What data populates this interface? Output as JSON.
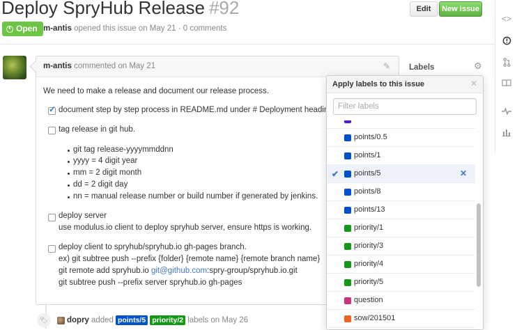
{
  "issue": {
    "title": "Deploy SpryHub Release",
    "number": "#92",
    "state": "Open",
    "author": "m-antis",
    "meta_text": "opened this issue on May 21 · 0 comments"
  },
  "header_buttons": {
    "edit": "Edit",
    "new_issue": "New issue"
  },
  "comment": {
    "author": "m-antis",
    "meta": "commented on May 21",
    "intro": "We need to make a release and document our release process.",
    "tasks": [
      {
        "checked": true,
        "text": "document step by step process in README.md under # Deployment heading."
      },
      {
        "checked": false,
        "text": "tag release in git hub."
      },
      {
        "checked": false,
        "text": "deploy server"
      },
      {
        "checked": false,
        "text": "deploy client to spryhub/spryhub.io gh-pages branch."
      }
    ],
    "tag_bullets": [
      "git tag release-yyyymmddnn",
      "yyyy = 4 digit year",
      "mm = 2 digit month",
      "dd = 2 digit day",
      "nn = manual release number or build number if generated by jenkins."
    ],
    "server_line": "use modulus.io client to deploy spryhub server, ensure https is working.",
    "client_lines": {
      "line1": "ex) git subtree push --prefix {folder} {remote name} {remote branch name}",
      "line2_prefix": "git remote add spryhub.io ",
      "line2_link": "git@github.com",
      "line2_suffix": ":spry-group/spryhub.io.git",
      "line3": "git subtree push --prefix server spryhub.io gh-pages"
    }
  },
  "event": {
    "actor": "dopry",
    "verb": "added",
    "labels": [
      {
        "name": "points/5",
        "color": "#0052cc"
      },
      {
        "name": "priority/2",
        "color": "#159818"
      }
    ],
    "suffix": "labels on May 26"
  },
  "sidebar": {
    "labels_heading": "Labels"
  },
  "dropdown": {
    "title": "Apply labels to this issue",
    "filter_placeholder": "Filter labels",
    "items": [
      {
        "name": "",
        "color": "#5319e7",
        "selected": false
      },
      {
        "name": "points/0.5",
        "color": "#0052cc",
        "selected": false
      },
      {
        "name": "points/1",
        "color": "#0052cc",
        "selected": false
      },
      {
        "name": "points/5",
        "color": "#0052cc",
        "selected": true
      },
      {
        "name": "points/8",
        "color": "#0052cc",
        "selected": false
      },
      {
        "name": "points/13",
        "color": "#0052cc",
        "selected": false
      },
      {
        "name": "priority/1",
        "color": "#159818",
        "selected": false
      },
      {
        "name": "priority/3",
        "color": "#159818",
        "selected": false
      },
      {
        "name": "priority/4",
        "color": "#159818",
        "selected": false
      },
      {
        "name": "priority/5",
        "color": "#159818",
        "selected": false
      },
      {
        "name": "question",
        "color": "#cc317c",
        "selected": false
      },
      {
        "name": "sow/201501",
        "color": "#eb6420",
        "selected": false
      },
      {
        "name": "",
        "color": "#eb6420",
        "selected": false
      }
    ]
  },
  "colors": {
    "open_green": "#6cc644",
    "link_blue": "#4078c0",
    "nav_accent": "#d26911"
  },
  "right_nav_icons": [
    "code-icon",
    "issues-icon",
    "pull-request-icon",
    "wiki-icon",
    "pulse-icon",
    "graphs-icon"
  ]
}
